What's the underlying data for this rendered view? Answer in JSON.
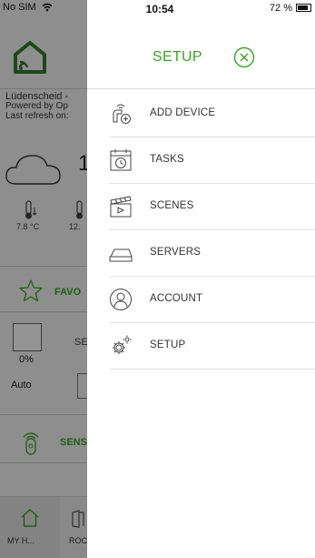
{
  "status_bar": {
    "carrier": "No SIM",
    "time": "10:54",
    "battery": "72 %"
  },
  "background": {
    "location": "Lüdenscheid -",
    "powered_by": "Powered by Op",
    "last_refresh": "Last refresh on:",
    "big_temp": "1",
    "temp_1": "7.8 °C",
    "temp_2": "12.",
    "favorites_label": "FAVO",
    "shutter_percent": "0%",
    "shutter_mode": "Auto",
    "shutter_name_partial": "SE",
    "sensors_label": "SENS",
    "tabs": [
      {
        "label": "MY H...",
        "icon": "home-icon",
        "active": true
      },
      {
        "label": "ROC",
        "icon": "rooms-icon",
        "active": false
      }
    ]
  },
  "drawer": {
    "title": "SETUP",
    "close_icon": "close-circle-icon",
    "accent_color": "#35a61c",
    "items": [
      {
        "label": "ADD DEVICE",
        "icon": "add-device-icon"
      },
      {
        "label": "TASKS",
        "icon": "tasks-calendar-icon"
      },
      {
        "label": "SCENES",
        "icon": "scenes-clapper-icon"
      },
      {
        "label": "SERVERS",
        "icon": "server-icon"
      },
      {
        "label": "ACCOUNT",
        "icon": "account-icon"
      },
      {
        "label": "SETUP",
        "icon": "gear-icon"
      }
    ]
  }
}
